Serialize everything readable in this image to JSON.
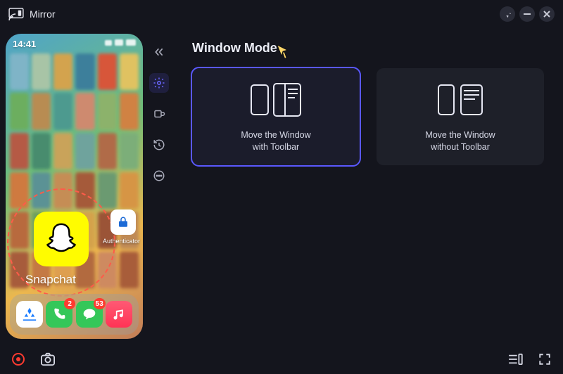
{
  "app": {
    "title": "Mirror"
  },
  "phone": {
    "clock": "14:41",
    "highlight_label": "Snapchat",
    "authenticator_label": "Authenticator",
    "dock_badges": {
      "phone": "2",
      "messages": "53"
    }
  },
  "settings": {
    "title": "Window Mode",
    "options": [
      {
        "line1": "Move the Window",
        "line2": "with Toolbar"
      },
      {
        "line1": "Move the Window",
        "line2": "without Toolbar"
      }
    ]
  }
}
